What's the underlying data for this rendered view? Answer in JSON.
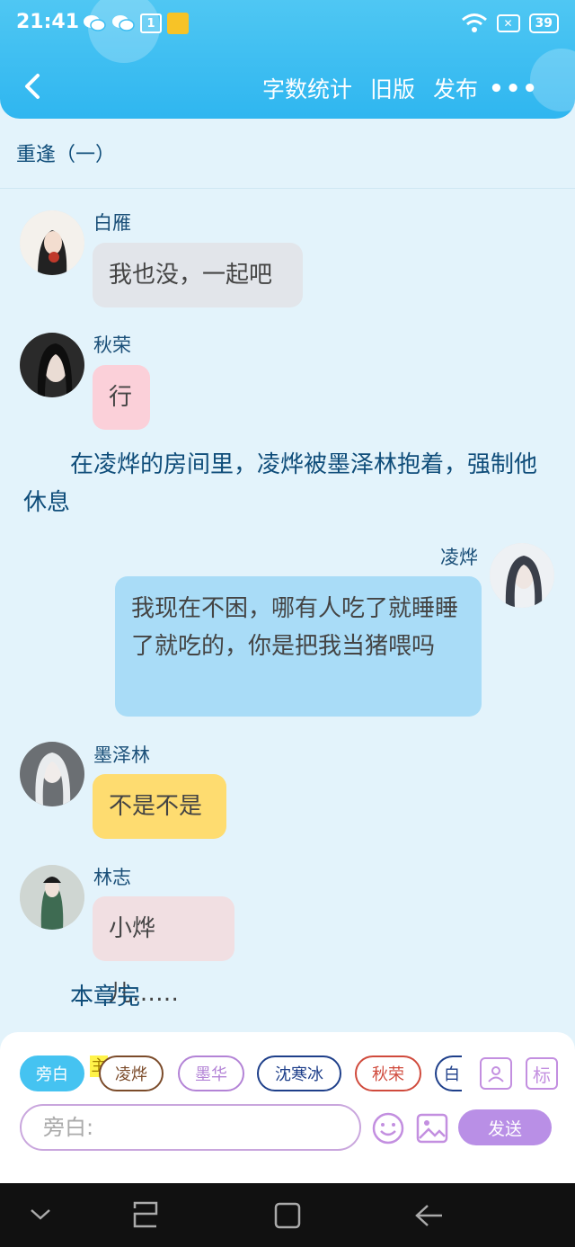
{
  "status_bar": {
    "time": "21:41",
    "sim_badge": "1",
    "battery": "39"
  },
  "header": {
    "actions": [
      "字数统计",
      "旧版",
      "发布"
    ],
    "more": "•••"
  },
  "chapter_title": "重逢（一）",
  "messages": [
    {
      "name": "白雁",
      "text": "我也没，一起吧",
      "bubble_color": "#e2e5ea"
    },
    {
      "name": "秋荣",
      "text": "行",
      "bubble_color": "#fbd0d9"
    },
    {
      "narration": "在凌烨的房间里，凌烨被墨泽林抱着，强制他休息"
    },
    {
      "name": "凌烨",
      "text": "我现在不困，哪有人吃了就睡睡了就吃的，你是把我当猪喂吗",
      "bubble_color": "#a9dcf7"
    },
    {
      "name": "墨泽林",
      "text": "不是不是",
      "bubble_color": "#fedc70"
    },
    {
      "name": "林志",
      "text": "小烨儿……",
      "bubble_color": "#f1dfe2"
    },
    {
      "narration": "本章完"
    }
  ],
  "composer": {
    "chips": [
      "旁白",
      "凌烨",
      "墨华",
      "沈寒冰",
      "秋荣",
      "白"
    ],
    "main_tag": "主",
    "tools": [
      "profile-icon",
      "标"
    ],
    "placeholder": "旁白:",
    "send": "发送"
  },
  "colors": {
    "header": "#3bbdf2",
    "background": "#e3f3fb",
    "accent": "#b98fe6"
  }
}
